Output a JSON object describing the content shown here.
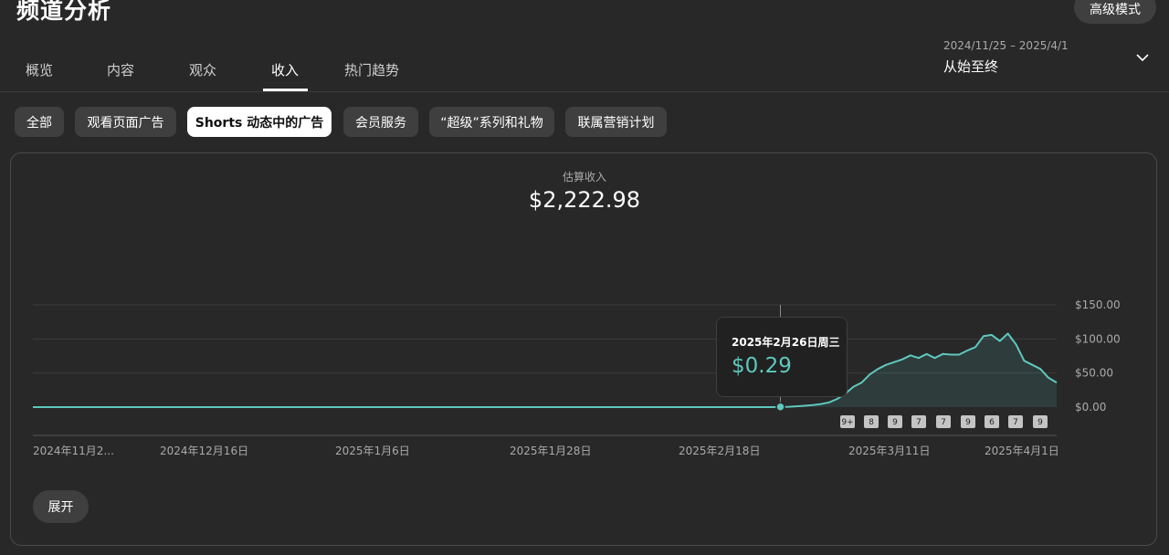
{
  "header": {
    "title": "频道分析",
    "advanced_button": "高级模式"
  },
  "tabs": [
    "概览",
    "内容",
    "观众",
    "收入",
    "热门趋势"
  ],
  "active_tab": "收入",
  "date_picker": {
    "range": "2024/11/25 – 2025/4/1",
    "label": "从始至终"
  },
  "filter_chips": [
    "全部",
    "观看页面广告",
    "Shorts 动态中的广告",
    "会员服务",
    "“超级”系列和礼物",
    "联属营销计划"
  ],
  "selected_chip": "Shorts 动态中的广告",
  "metric": {
    "label": "估算收入",
    "value": "$2,222.98"
  },
  "tooltip": {
    "date": "2025年2月26日周三",
    "value": "$0.29"
  },
  "expand_button": "展开",
  "colors": {
    "line": "#5fc8be",
    "background": "#282828"
  },
  "badges": [
    "9+",
    "8",
    "9",
    "7",
    "7",
    "9",
    "6",
    "7",
    "9"
  ],
  "chart_data": {
    "type": "area",
    "x_tick_labels": [
      "2024年11月2...",
      "2024年12月16日",
      "2025年1月6日",
      "2025年1月28日",
      "2025年2月18日",
      "2025年3月11日",
      "2025年4月1日"
    ],
    "y_tick_labels": [
      "$150.00",
      "$100.00",
      "$50.00",
      "$0.00"
    ],
    "ylim": [
      0,
      150
    ],
    "x_start": "2024-11-25",
    "x_end": "2025-04-01",
    "series": [
      {
        "values": [
          0,
          0,
          0,
          0,
          0,
          0,
          0,
          0,
          0,
          0,
          0,
          0,
          0,
          0,
          0,
          0,
          0,
          0,
          0,
          0,
          0,
          0,
          0,
          0,
          0,
          0,
          0,
          0,
          0,
          0,
          0,
          0,
          0,
          0,
          0,
          0,
          0,
          0,
          0,
          0,
          0,
          0,
          0,
          0,
          0,
          0,
          0,
          0,
          0,
          0,
          0,
          0,
          0,
          0,
          0,
          0,
          0,
          0,
          0,
          0,
          0,
          0,
          0,
          0,
          0,
          0,
          0,
          0,
          0,
          0,
          0,
          0,
          0,
          0,
          0,
          0,
          0,
          0,
          0,
          0,
          0,
          0,
          0,
          0,
          0,
          0,
          0,
          0,
          0,
          0,
          0,
          0,
          0.29,
          0.6,
          1.2,
          2,
          3,
          4.5,
          7,
          12,
          20,
          30,
          36,
          48,
          56,
          62,
          66,
          70,
          76,
          72,
          78,
          72,
          78,
          77,
          77,
          83,
          88,
          104,
          106,
          97,
          108,
          92,
          68,
          62,
          56,
          43,
          36
        ]
      }
    ]
  }
}
